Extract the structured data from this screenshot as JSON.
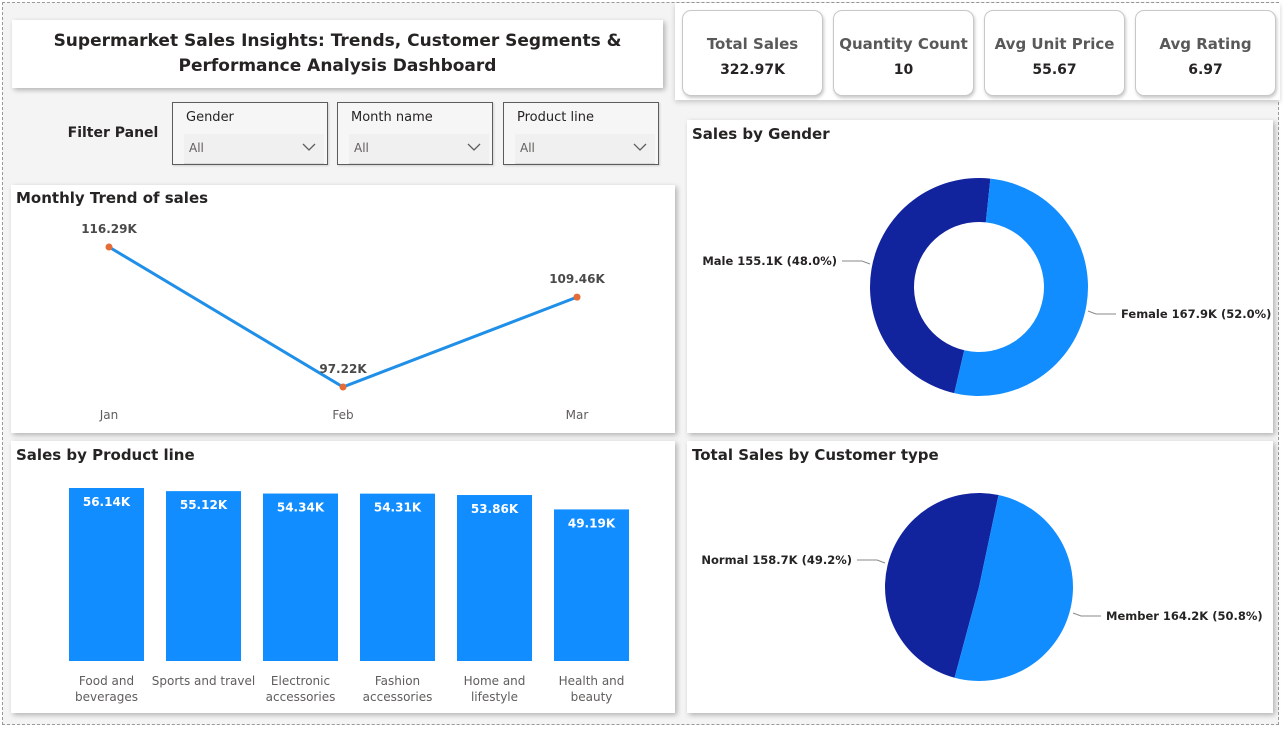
{
  "header": {
    "title": "Supermarket Sales Insights: Trends, Customer Segments & Performance Analysis Dashboard"
  },
  "kpis": [
    {
      "label": "Total Sales",
      "value": "322.97K"
    },
    {
      "label": "Quantity Count",
      "value": "10"
    },
    {
      "label": "Avg Unit Price",
      "value": "55.67"
    },
    {
      "label": "Avg Rating",
      "value": "6.97"
    }
  ],
  "filters": {
    "panel_label": "Filter Panel",
    "slicers": [
      {
        "title": "Gender",
        "value": "All",
        "icon": "chevron-down-icon"
      },
      {
        "title": "Month name",
        "value": "All",
        "icon": "chevron-down-icon"
      },
      {
        "title": "Product line",
        "value": "All",
        "icon": "chevron-down-icon"
      }
    ]
  },
  "colors": {
    "accent": "#118dff",
    "dark_blue": "#12239e",
    "marker": "#e66c37",
    "line": "#1f8fe8"
  },
  "chart_data": [
    {
      "type": "line",
      "title": "Monthly Trend of sales",
      "categories": [
        "Jan",
        "Feb",
        "Mar"
      ],
      "values": [
        116.29,
        97.22,
        109.46
      ],
      "labels": [
        "116.29K",
        "97.22K",
        "109.46K"
      ],
      "unit": "K",
      "ylim": [
        97.22,
        116.29
      ],
      "grid": false
    },
    {
      "type": "pie",
      "donut": true,
      "title": "Sales by Gender",
      "slices": [
        {
          "name": "Male",
          "value": 155.1,
          "percent": 48.0,
          "label": "Male 155.1K (48.0%)",
          "color": "#12239e"
        },
        {
          "name": "Female",
          "value": 167.9,
          "percent": 52.0,
          "label": "Female 167.9K (52.0%)",
          "color": "#118dff"
        }
      ]
    },
    {
      "type": "bar",
      "title": "Sales by Product line",
      "categories": [
        [
          "Food and",
          "beverages"
        ],
        [
          "Sports and travel"
        ],
        [
          "Electronic",
          "accessories"
        ],
        [
          "Fashion",
          "accessories"
        ],
        [
          "Home and",
          "lifestyle"
        ],
        [
          "Health and",
          "beauty"
        ]
      ],
      "values": [
        56.14,
        55.12,
        54.34,
        54.31,
        53.86,
        49.19
      ],
      "labels": [
        "56.14K",
        "55.12K",
        "54.34K",
        "54.31K",
        "53.86K",
        "49.19K"
      ],
      "unit": "K",
      "grid": false
    },
    {
      "type": "pie",
      "donut": false,
      "title": "Total Sales by Customer type",
      "slices": [
        {
          "name": "Normal",
          "value": 158.7,
          "percent": 49.2,
          "label": "Normal 158.7K (49.2%)",
          "color": "#12239e"
        },
        {
          "name": "Member",
          "value": 164.2,
          "percent": 50.8,
          "label": "Member 164.2K (50.8%)",
          "color": "#118dff"
        }
      ]
    }
  ]
}
